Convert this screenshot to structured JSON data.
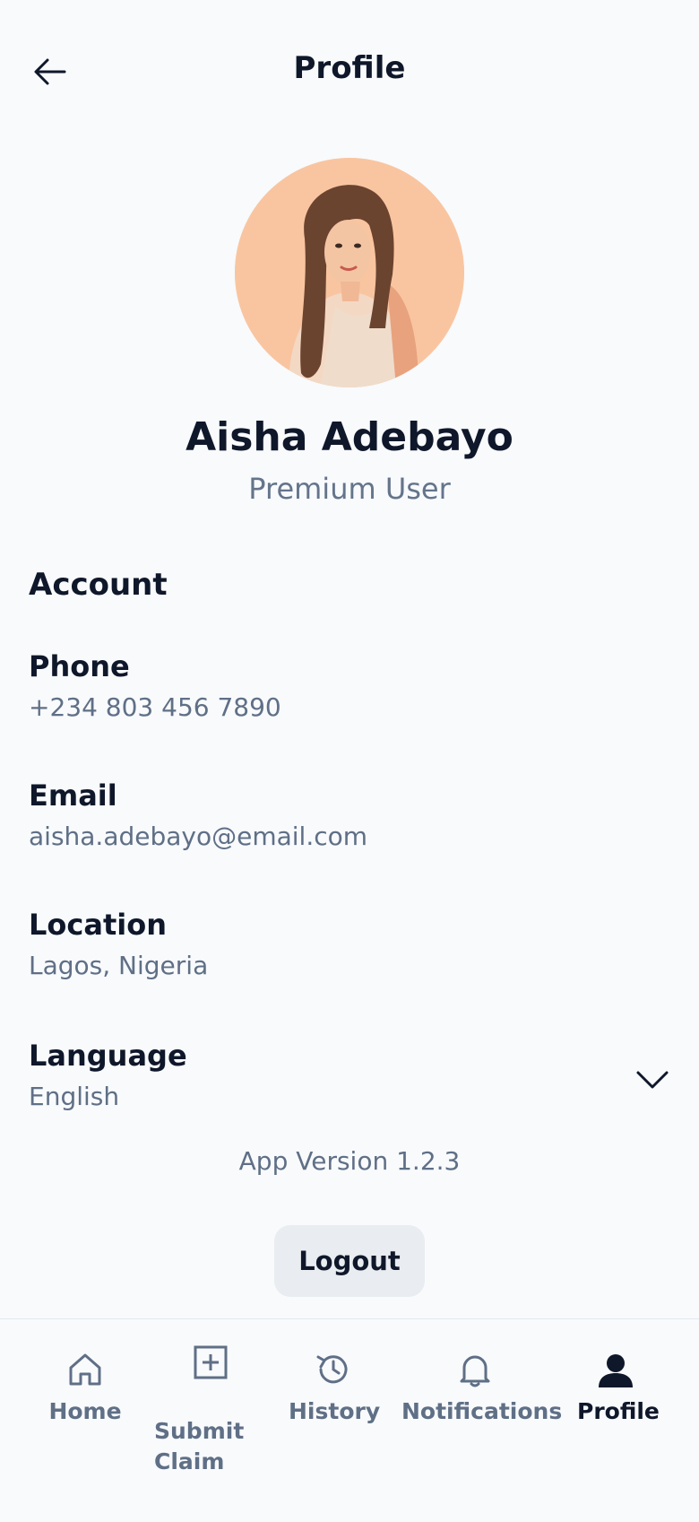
{
  "header": {
    "title": "Profile"
  },
  "profile": {
    "name": "Aisha Adebayo",
    "role": "Premium User"
  },
  "account": {
    "section_title": "Account",
    "phone": {
      "label": "Phone",
      "value": "+234 803 456 7890"
    },
    "email": {
      "label": "Email",
      "value": "aisha.adebayo@email.com"
    },
    "location": {
      "label": "Location",
      "value": "Lagos, Nigeria"
    },
    "language": {
      "label": "Language",
      "value": "English"
    }
  },
  "footer": {
    "version": "App Version 1.2.3",
    "logout_label": "Logout"
  },
  "tabs": [
    {
      "label": "Home",
      "icon": "home-icon"
    },
    {
      "label": "Submit Claim",
      "icon": "plus-square-icon"
    },
    {
      "label": "History",
      "icon": "history-icon"
    },
    {
      "label": "Notifications",
      "icon": "bell-icon"
    },
    {
      "label": "Profile",
      "icon": "user-icon",
      "active": true
    }
  ],
  "colors": {
    "background": "#f8fafc",
    "muted": "#5f6f86",
    "text": "#0f172a",
    "avatar_bg": "#f9c5a0"
  }
}
